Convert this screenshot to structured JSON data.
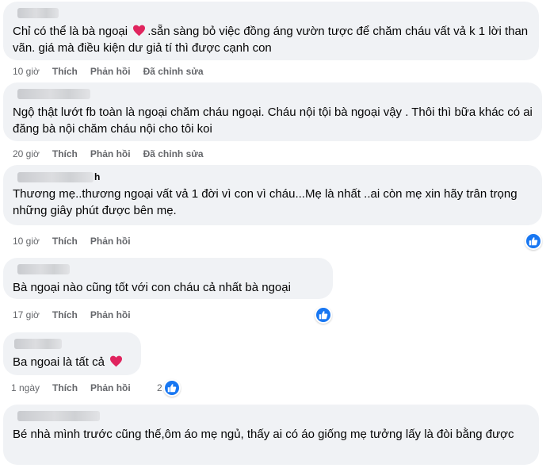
{
  "comments": [
    {
      "text_before": "Chỉ có thể là bà ngoại ",
      "text_after": ".sẵn sàng bỏ việc đồng áng vườn tược để chăm cháu vất vả k 1 lời than vãn. giá mà điều kiện dư giả tí thì được cạnh con",
      "time": "10 giờ",
      "like": "Thích",
      "reply": "Phản hồi",
      "edited": "Đã chỉnh sửa"
    },
    {
      "text": "Ngộ thật lướt fb toàn là ngoại chăm cháu ngoại. Cháu nội tội bà ngoại vậy . Thôi thì bữa khác có ai đăng bà nội chăm cháu nội cho tôi koi",
      "time": "20 giờ",
      "like": "Thích",
      "reply": "Phản hồi",
      "edited": "Đã chỉnh sửa"
    },
    {
      "name_tail": "h",
      "text": "Thương mẹ..thương ngoại vất vả 1 đời vì con vì cháu...Mẹ là nhất ..ai còn mẹ xin hãy trân trọng những giây phút được bên mẹ.",
      "time": "10 giờ",
      "like": "Thích",
      "reply": "Phản hồi"
    },
    {
      "text": "Bà ngoại nào cũng tốt với con cháu cả nhất bà ngoại",
      "time": "17 giờ",
      "like": "Thích",
      "reply": "Phản hồi"
    },
    {
      "text": "Ba ngoai là tất cả ",
      "time": "1 ngày",
      "like": "Thích",
      "reply": "Phản hồi",
      "reaction_count": "2"
    },
    {
      "text": "Bé nhà mình trước cũng thế,ôm áo mẹ ngủ, thấy ai có áo giống mẹ tưởng lấy là đòi bằng được"
    }
  ],
  "icons": {
    "heart": "heart-emoji-icon",
    "like": "like-reaction-icon"
  },
  "colors": {
    "bubble": "#f0f2f5",
    "meta": "#65676b",
    "like_blue": "#1877f2",
    "heart_red": "#e0245e"
  }
}
